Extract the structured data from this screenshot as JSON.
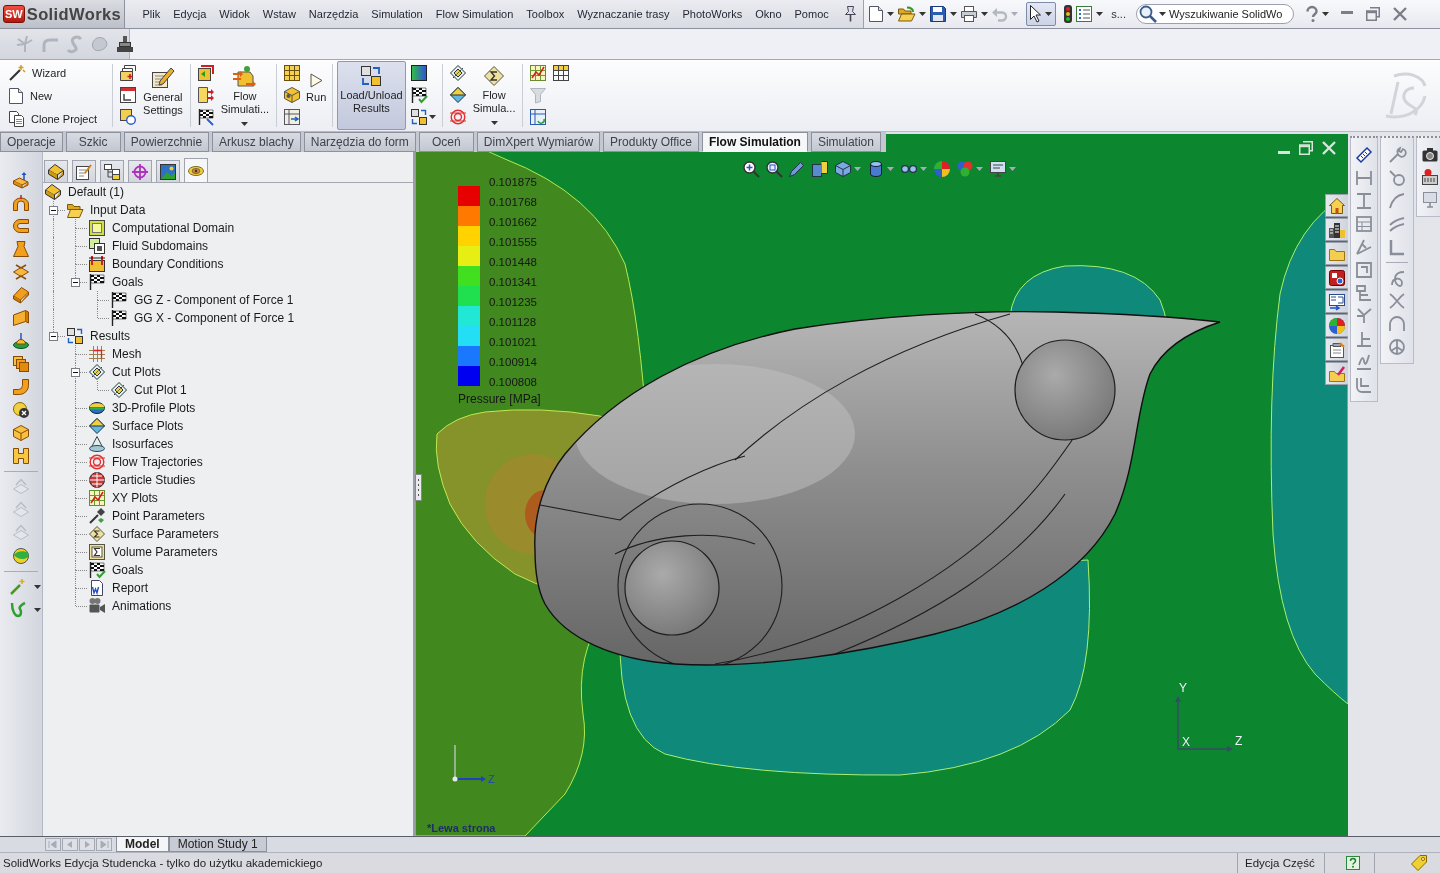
{
  "menu_bar": {
    "logo_mark": "SW",
    "logo": "SolidWorks",
    "menus": [
      "Plik",
      "Edycja",
      "Widok",
      "Wstaw",
      "Narzędzia",
      "Simulation",
      "Flow Simulation",
      "Toolbox",
      "Wyznaczanie trasy",
      "PhotoWorks",
      "Okno",
      "Pomoc"
    ],
    "quick_label": "s...",
    "search": {
      "placeholder": "Wyszukiwanie SolidWo"
    }
  },
  "command_manager": [
    {
      "kind": "stack",
      "items": [
        "Wizard",
        "New",
        "Clone Project"
      ]
    },
    {
      "kind": "large",
      "label": "General Settings",
      "pressed": false,
      "dropdown": false
    },
    {
      "kind": "large",
      "label": "Flow Simulati...",
      "pressed": false,
      "dropdown": true
    },
    {
      "kind": "small",
      "label": "Run"
    },
    {
      "kind": "large",
      "label": "Load/Unload Results",
      "pressed": true,
      "dropdown": false
    },
    {
      "kind": "large",
      "label": "Flow Simula...",
      "pressed": false,
      "dropdown": true
    }
  ],
  "tabs": [
    {
      "label": "Operacje",
      "selected": false
    },
    {
      "label": "Szkic",
      "selected": false
    },
    {
      "label": "Powierzchnie",
      "selected": false
    },
    {
      "label": "Arkusz blachy",
      "selected": false
    },
    {
      "label": "Narzędzia do form",
      "selected": false
    },
    {
      "label": "Oceń",
      "selected": false
    },
    {
      "label": "DimXpert Wymiarów",
      "selected": false
    },
    {
      "label": "Produkty Office",
      "selected": false
    },
    {
      "label": "Flow Simulation",
      "selected": true
    },
    {
      "label": "Simulation",
      "selected": false
    }
  ],
  "panel_tabs": [
    {
      "selected": false
    },
    {
      "selected": false
    },
    {
      "selected": false
    },
    {
      "selected": false
    },
    {
      "selected": false
    },
    {
      "selected": true
    }
  ],
  "feature_tree": {
    "root": "Default (1)",
    "items": [
      {
        "label": "Input Data",
        "expanded": true,
        "children": [
          {
            "label": "Computational Domain"
          },
          {
            "label": "Fluid Subdomains"
          },
          {
            "label": "Boundary Conditions"
          },
          {
            "label": "Goals",
            "expanded": true,
            "children": [
              {
                "label": "GG Z - Component of Force 1"
              },
              {
                "label": "GG X - Component of Force 1"
              }
            ]
          }
        ]
      },
      {
        "label": "Results",
        "expanded": true,
        "children": [
          {
            "label": "Mesh"
          },
          {
            "label": "Cut Plots",
            "expanded": true,
            "children": [
              {
                "label": "Cut Plot 1"
              }
            ]
          },
          {
            "label": "3D-Profile Plots"
          },
          {
            "label": "Surface Plots"
          },
          {
            "label": "Isosurfaces"
          },
          {
            "label": "Flow Trajectories"
          },
          {
            "label": "Particle Studies"
          },
          {
            "label": "XY Plots"
          },
          {
            "label": "Point Parameters"
          },
          {
            "label": "Surface Parameters"
          },
          {
            "label": "Volume Parameters"
          },
          {
            "label": "Goals"
          },
          {
            "label": "Report"
          },
          {
            "label": "Animations"
          }
        ]
      }
    ]
  },
  "viewport": {
    "legend": {
      "labels": [
        "0.101875",
        "0.101768",
        "0.101662",
        "0.101555",
        "0.101448",
        "0.101341",
        "0.101235",
        "0.101128",
        "0.101021",
        "0.100914",
        "0.100808"
      ],
      "bands": [
        {
          "color": "#e60000"
        },
        {
          "color": "#ff7800"
        },
        {
          "color": "#ffd200"
        },
        {
          "color": "#e6ee14"
        },
        {
          "color": "#40e020"
        },
        {
          "color": "#20e050"
        },
        {
          "color": "#20e8d4"
        },
        {
          "color": "#24def6"
        },
        {
          "color": "#1a78ff"
        },
        {
          "color": "#0000f0"
        }
      ],
      "title": "Pressure [MPa]"
    },
    "triad_labels": [
      "Y",
      "X",
      "Z"
    ],
    "mini_triad_label": "Z",
    "view_name": "*Lewa strona"
  },
  "bottom_tabs": [
    {
      "label": "Model",
      "selected": true
    },
    {
      "label": "Motion Study 1",
      "selected": false
    }
  ],
  "status_bar": {
    "message": "SolidWorks Edycja Studencka - tylko do użytku akademickiego",
    "mode": "Edycja Część"
  }
}
